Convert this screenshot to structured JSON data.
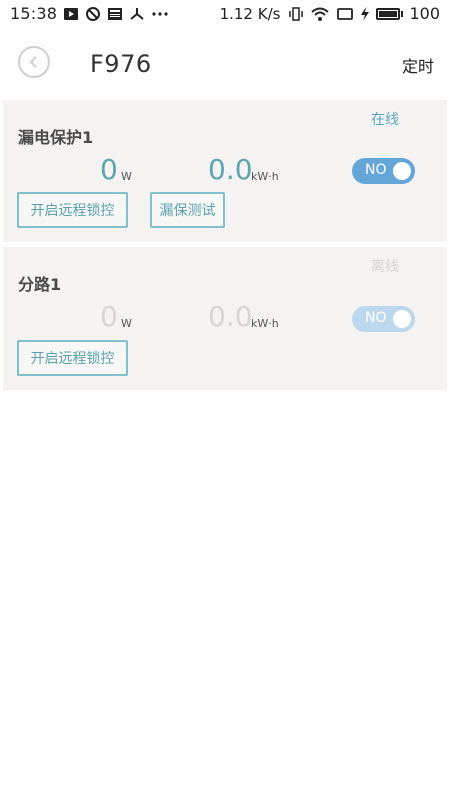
{
  "status_bar": {
    "time": "15:38",
    "speed": "1.12 K/s",
    "battery": "100"
  },
  "header": {
    "title": "F976",
    "timer_label": "定时"
  },
  "devices": [
    {
      "name": "漏电保护1",
      "status": "在线",
      "power_value": "0",
      "power_unit": "W",
      "energy_value": "0.0",
      "energy_unit": "kW·h",
      "toggle_label": "NO",
      "buttons": [
        "开启远程锁控",
        "漏保测试"
      ]
    },
    {
      "name": "分路1",
      "status": "离线",
      "power_value": "0",
      "power_unit": "W",
      "energy_value": "0.0",
      "energy_unit": "kW·h",
      "toggle_label": "NO",
      "buttons": [
        "开启远程锁控"
      ]
    }
  ],
  "colors": {
    "accent": "#5ea5b0",
    "toggle_on": "#64a6d7",
    "toggle_off": "#bcd8ef",
    "card_bg": "#f4f3f2"
  }
}
